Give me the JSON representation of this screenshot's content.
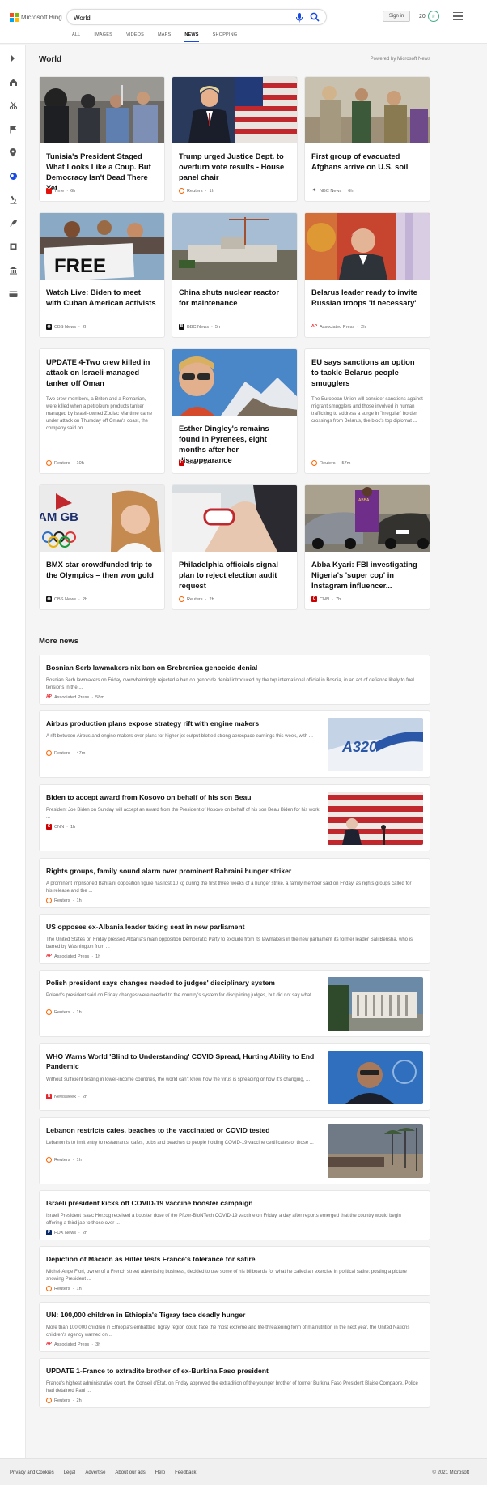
{
  "header": {
    "logo_text": "Microsoft Bing",
    "search_value": "World",
    "signin_label": "Sign in",
    "rewards_count": "20",
    "tabs": [
      {
        "label": "ALL"
      },
      {
        "label": "IMAGES"
      },
      {
        "label": "VIDEOS"
      },
      {
        "label": "MAPS"
      },
      {
        "label": "NEWS"
      },
      {
        "label": "SHOPPING"
      }
    ],
    "active_tab": "NEWS"
  },
  "sidebar": {
    "icons": [
      "chevron-right-icon",
      "home-icon",
      "scissors-icon",
      "flag-icon",
      "location-pin-icon",
      "globe-icon",
      "microscope-icon",
      "rocket-icon",
      "film-icon",
      "bank-icon",
      "credit-card-icon"
    ],
    "active": "globe-icon"
  },
  "section": {
    "title": "World",
    "powered_by": "Powered by Microsoft News"
  },
  "cards": [
    {
      "title": "Tunisia's President Staged What Looks Like a Coup. But Democracy Isn't Dead There Yet",
      "provider": "Time",
      "time": "6h",
      "snippet": ""
    },
    {
      "title": "Trump urged Justice Dept. to overturn vote results - House panel chair",
      "provider": "Reuters",
      "time": "1h",
      "snippet": ""
    },
    {
      "title": "First group of evacuated Afghans arrive on U.S. soil",
      "provider": "NBC News",
      "time": "6h",
      "snippet": ""
    },
    {
      "title": "Watch Live: Biden to meet with Cuban American activists",
      "provider": "CBS News",
      "time": "2h",
      "snippet": ""
    },
    {
      "title": "China shuts nuclear reactor for maintenance",
      "provider": "BBC News",
      "time": "5h",
      "snippet": ""
    },
    {
      "title": "Belarus leader ready to invite Russian troops 'if necessary'",
      "provider": "Associated Press",
      "time": "2h",
      "snippet": ""
    },
    {
      "title": "UPDATE 4-Two crew killed in attack on Israeli-managed tanker off Oman",
      "provider": "Reuters",
      "time": "10h",
      "snippet": "Two crew members, a Briton and a Romanian, were killed when a petroleum products tanker managed by Israeli-owned Zodiac Maritime came under attack on Thursday off Oman's coast, the company said on ..."
    },
    {
      "title": "Esther Dingley's remains found in Pyrenees, eight months after her disappearance",
      "provider": "CNN",
      "time": "1h",
      "snippet": ""
    },
    {
      "title": "EU says sanctions an option to tackle Belarus people smugglers",
      "provider": "Reuters",
      "time": "57m",
      "snippet": "The European Union will consider sanctions against migrant smugglers and those involved in human trafficking to address a surge in \"irregular\" border crossings from Belarus, the bloc's top diplomat ..."
    },
    {
      "title": "BMX star crowdfunded trip to the Olympics – then won gold",
      "provider": "CBS News",
      "time": "2h",
      "snippet": ""
    },
    {
      "title": "Philadelphia officials signal plan to reject election audit request",
      "provider": "Reuters",
      "time": "2h",
      "snippet": ""
    },
    {
      "title": "Abba Kyari: FBI investigating Nigeria's 'super cop' in Instagram influencer...",
      "provider": "CNN",
      "time": "7h",
      "snippet": ""
    }
  ],
  "more_news": {
    "title": "More news",
    "items": [
      {
        "title": "Bosnian Serb lawmakers nix ban on Srebrenica genocide denial",
        "snippet": "Bosnian Serb lawmakers on Friday overwhelmingly rejected a ban on genocide denial introduced by the top international official in Bosnia, in an act of defiance likely to fuel tensions in the ...",
        "provider": "Associated Press",
        "time": "58m"
      },
      {
        "title": "Airbus production plans expose strategy rift with engine makers",
        "snippet": "A rift between Airbus and engine makers over plans for higher jet output blotted strong aerospace earnings this week, with ...",
        "provider": "Reuters",
        "time": "47m",
        "thumb_text": "A320"
      },
      {
        "title": "Biden to accept award from Kosovo on behalf of his son Beau",
        "snippet": "President Joe Biden on Sunday will accept an award from the President of Kosovo on behalf of his son Beau Biden for his work ...",
        "provider": "CNN",
        "time": "1h"
      },
      {
        "title": "Rights groups, family sound alarm over prominent Bahraini hunger striker",
        "snippet": "A prominent imprisoned Bahraini opposition figure has lost 10 kg during the first three weeks of a hunger strike, a family member said on Friday, as rights groups called for his release and the ...",
        "provider": "Reuters",
        "time": "1h"
      },
      {
        "title": "US opposes ex-Albania leader taking seat in new parliament",
        "snippet": "The United States on Friday pressed Albania's main opposition Democratic Party to exclude from its lawmakers in the new parliament its former leader Sali Berisha, who is barred by Washington from ...",
        "provider": "Associated Press",
        "time": "1h"
      },
      {
        "title": "Polish president says changes needed to judges' disciplinary system",
        "snippet": "Poland's president said on Friday changes were needed to the country's system for disciplining judges, but did not say what ...",
        "provider": "Reuters",
        "time": "1h"
      },
      {
        "title": "WHO Warns World 'Blind to Understanding' COVID Spread, Hurting Ability to End Pandemic",
        "snippet": "Without sufficient testing in lower-income countries, the world can't know how the virus is spreading or how it's changing, ...",
        "provider": "Newsweek",
        "time": "2h"
      },
      {
        "title": "Lebanon restricts cafes, beaches to the vaccinated or COVID tested",
        "snippet": "Lebanon is to limit entry to restaurants, cafes, pubs and beaches to people holding COVID-19 vaccine certificates or those ...",
        "provider": "Reuters",
        "time": "1h"
      },
      {
        "title": "Israeli president kicks off COVID-19 vaccine booster campaign",
        "snippet": "Israeli President Isaac Herzog received a booster dose of the Pfizer-BioNTech COVID-19 vaccine on Friday, a day after reports emerged that the country would begin offering a third jab to those over ...",
        "provider": "FOX News",
        "time": "2h"
      },
      {
        "title": "Depiction of Macron as Hitler tests France's tolerance for satire",
        "snippet": "Michel-Ange Flori, owner of a French street advertising business, decided to use some of his billboards for what he called an exercise in political satire: posting a picture showing President ...",
        "provider": "Reuters",
        "time": "1h"
      },
      {
        "title": "UN: 100,000 children in Ethiopia's Tigray face deadly hunger",
        "snippet": "More than 100,000 children in Ethiopia's embattled Tigray region could face the most extreme and life-threatening form of malnutrition in the next year, the United Nations children's agency warned on ...",
        "provider": "Associated Press",
        "time": "3h"
      },
      {
        "title": "UPDATE 1-France to extradite brother of ex-Burkina Faso president",
        "snippet": "France's highest administrative court, the Conseil d'Etat, on Friday approved the extradition of the younger brother of former Burkina Faso President Blaise Compaore. Police had detained Paul ...",
        "provider": "Reuters",
        "time": "2h"
      }
    ]
  },
  "card_images": {
    "free_sign_text": "FREE",
    "team_gb_text": "AM GB",
    "abba_text": "ABBA"
  },
  "footer": {
    "links": [
      "Privacy and Cookies",
      "Legal",
      "Advertise",
      "About our ads",
      "Help",
      "Feedback"
    ],
    "copyright": "© 2021 Microsoft"
  },
  "colors": {
    "accent": "#174ae4",
    "reuters": "#fa6400",
    "cnn": "#cc0000",
    "ap": "#e8262d"
  }
}
